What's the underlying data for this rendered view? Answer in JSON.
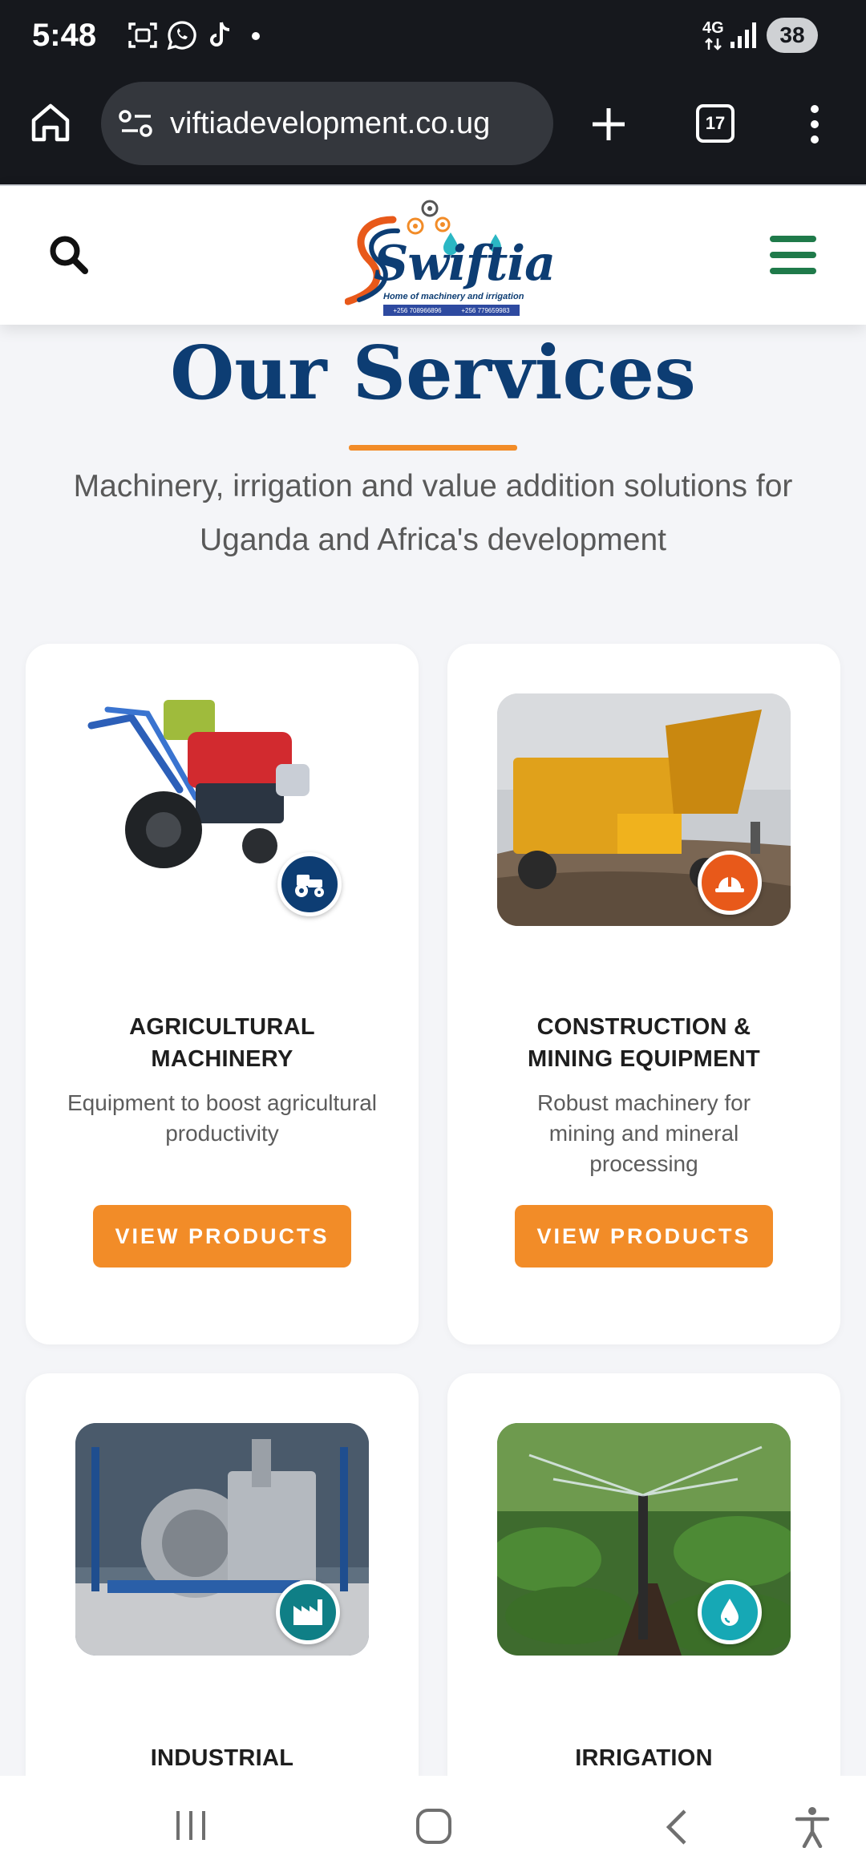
{
  "status": {
    "time": "5:48",
    "notification_icons": [
      "screenshot-icon",
      "whatsapp-icon",
      "tiktok-icon",
      "dot-icon"
    ],
    "network": "4G",
    "battery": "38"
  },
  "browser": {
    "url": "viftiadevelopment.co.ug",
    "tab_count": "17"
  },
  "site": {
    "logo_text": "Swiftia",
    "logo_tagline": "Home of machinery and irrigation",
    "logo_phone_1": "+256 708966896",
    "logo_phone_2": "+256 779659983"
  },
  "hero": {
    "title": "Our Services",
    "subtitle": "Machinery, irrigation and value addition solutions for Uganda and Africa's development"
  },
  "cards": [
    {
      "title": "AGRICULTURAL MACHINERY",
      "description": "Equipment to boost agricultural productivity",
      "button": "VIEW PRODUCTS",
      "badge_icon": "tractor-icon",
      "badge_color": "#0d3d73"
    },
    {
      "title": "CONSTRUCTION & MINING EQUIPMENT",
      "description": "Robust machinery for mining and mineral processing",
      "button": "VIEW PRODUCTS",
      "badge_icon": "hard-hat-icon",
      "badge_color": "#e8591a"
    },
    {
      "title": "INDUSTRIAL",
      "badge_icon": "factory-icon",
      "badge_color": "#0f7f86"
    },
    {
      "title": "IRRIGATION",
      "badge_icon": "water-drop-icon",
      "badge_color": "#16a8b5"
    }
  ],
  "colors": {
    "brand_navy": "#0d3d73",
    "accent_orange": "#f28c28",
    "menu_green": "#1f7a4a"
  }
}
